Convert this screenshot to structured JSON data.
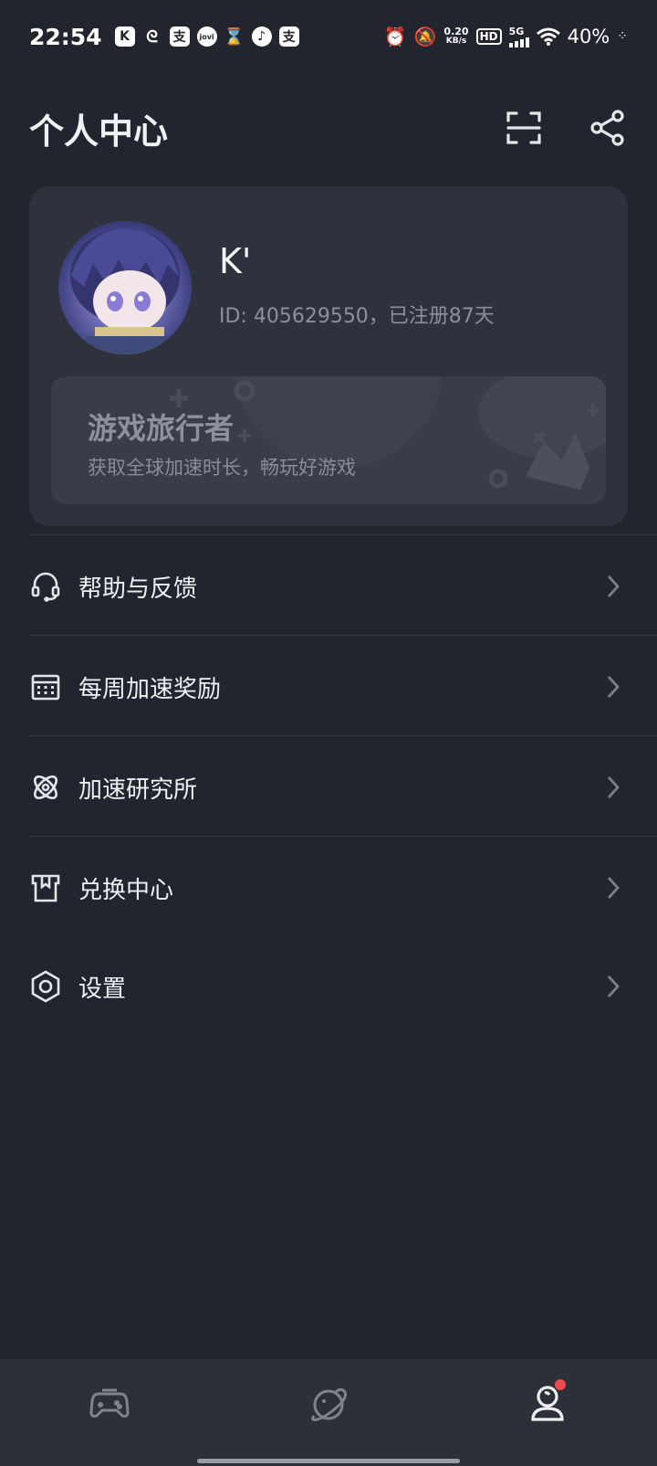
{
  "status_bar": {
    "time": "22:54",
    "net_speed_value": "0.20",
    "net_speed_unit": "KB/s",
    "hd": "HD",
    "network": "5G",
    "battery": "40%"
  },
  "header": {
    "title": "个人中心",
    "scan_icon": "scan-icon",
    "share_icon": "share-icon"
  },
  "profile": {
    "username": "K'",
    "meta": "ID: 405629550，已注册87天",
    "tier_title": "游戏旅行者",
    "tier_subtitle": "获取全球加速时长，畅玩好游戏"
  },
  "menu": {
    "items": [
      {
        "label": "帮助与反馈",
        "icon": "headset-icon"
      },
      {
        "label": "每周加速奖励",
        "icon": "calendar-icon"
      },
      {
        "label": "加速研究所",
        "icon": "atom-icon"
      },
      {
        "label": "兑换中心",
        "icon": "gift-box-icon"
      },
      {
        "label": "设置",
        "icon": "settings-icon"
      }
    ]
  },
  "bottom_nav": {
    "tabs": [
      {
        "name": "games",
        "icon": "gamepad-icon"
      },
      {
        "name": "explore",
        "icon": "planet-icon"
      },
      {
        "name": "profile",
        "icon": "user-icon",
        "active": true,
        "badge": true
      }
    ],
    "badge_color": "#f04a4f"
  },
  "colors": {
    "background": "#23252e",
    "card": "#2f323d",
    "banner": "#3a3d48"
  }
}
